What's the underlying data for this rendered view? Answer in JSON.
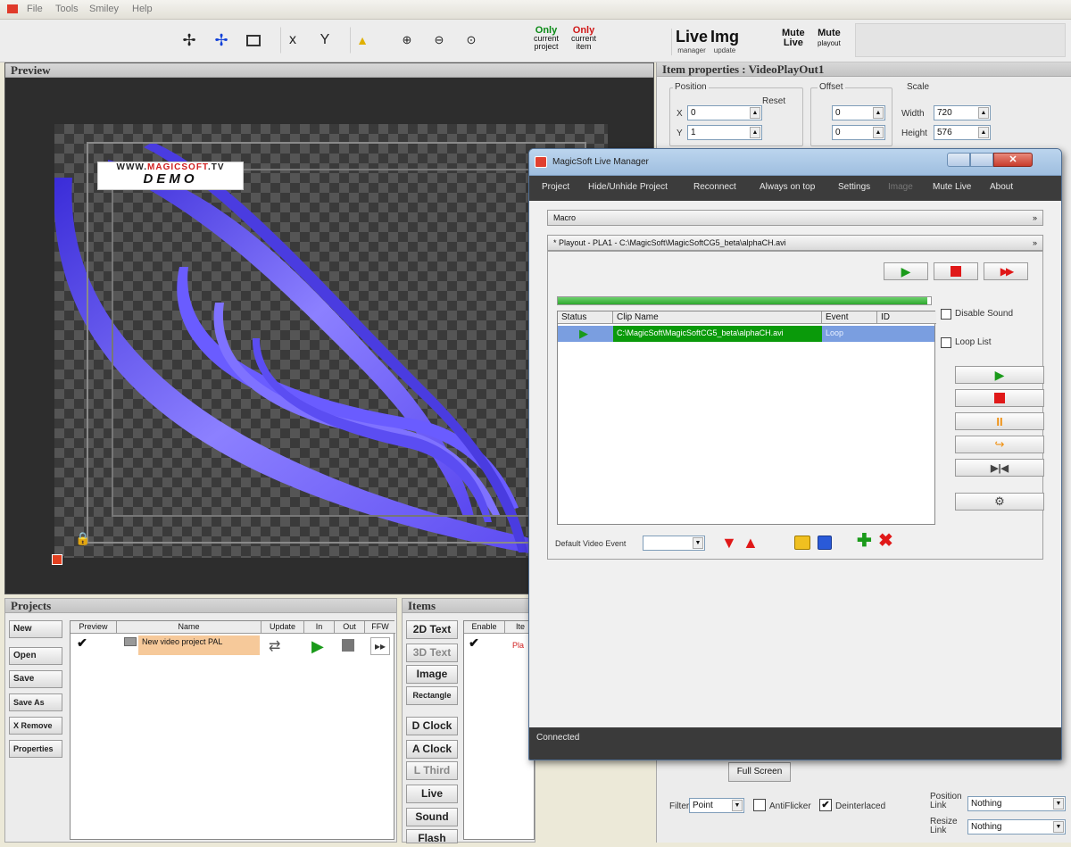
{
  "menu": {
    "items": [
      "File",
      "Tools",
      "Smiley",
      "Help"
    ]
  },
  "toolbar": {
    "only_project": {
      "top": "Only",
      "sub": "current project"
    },
    "only_item": {
      "top": "Only",
      "sub": "current item"
    },
    "live": {
      "title": "Live",
      "sub": "manager"
    },
    "img": {
      "title": "Img",
      "sub": "update"
    },
    "mute_live": {
      "title": "Mute",
      "sub": "Live"
    },
    "mute_playout": {
      "title": "Mute",
      "sub": "playout"
    }
  },
  "preview": {
    "title": "Preview",
    "logo_line1_a": "WWW.",
    "logo_line1_b": "MAGICSOFT",
    "logo_line1_c": ".TV",
    "logo_line2": "DEMO"
  },
  "props": {
    "title": "Item properties : VideoPlayOut1",
    "position": "Position",
    "reset": "Reset",
    "x": "X",
    "y": "Y",
    "x_val": "0",
    "y_val": "1",
    "offset": "Offset",
    "ox_val": "0",
    "oy_val": "0",
    "scale": "Scale",
    "width": "Width",
    "width_val": "720",
    "height": "Height",
    "height_val": "576",
    "fullscreen": "Full Screen",
    "filter": "Filter",
    "filter_val": "Point",
    "antiflicker": "AntiFlicker",
    "deinterlaced": "Deinterlaced",
    "position_link": "Position Link",
    "position_link_val": "Nothing",
    "resize_link": "Resize Link",
    "resize_link_val": "Nothing"
  },
  "projects": {
    "title": "Projects",
    "buttons": [
      "New",
      "Open",
      "Save",
      "Save As",
      "X Remove",
      "Properties"
    ],
    "cols": [
      "Preview",
      "Name",
      "Update",
      "In",
      "Out",
      "FFW"
    ],
    "row_name": "New video project PAL"
  },
  "items": {
    "title": "Items",
    "buttons": [
      "2D Text",
      "3D Text",
      "Image",
      "Rectangle",
      "D Clock",
      "A Clock",
      "L Third",
      "Live",
      "Sound",
      "Flash"
    ],
    "cols": [
      "Enable",
      "Ite"
    ],
    "row": "Pla"
  },
  "live": {
    "title": "MagicSoft Live Manager",
    "menu": [
      "Project",
      "Hide/Unhide Project",
      "Reconnect",
      "Always on top",
      "Settings",
      "Image",
      "Mute Live",
      "About"
    ],
    "macro": "Macro",
    "playout": "* Playout - PLA1 - C:\\MagicSoft\\MagicSoftCG5_beta\\alphaCH.avi",
    "cols": [
      "Status",
      "Clip Name",
      "Event",
      "ID"
    ],
    "clip": "C:\\MagicSoft\\MagicSoftCG5_beta\\alphaCH.avi",
    "event": "Loop",
    "progress": 0.99,
    "disable_sound": "Disable Sound",
    "loop_list": "Loop List",
    "default_event": "Default Video Event",
    "status": "Connected"
  },
  "colors": {
    "accent_green": "#1a9a1a",
    "stop_red": "#e01818",
    "selection_blue": "#7a9ee0",
    "swoosh": "#6a5cff"
  }
}
